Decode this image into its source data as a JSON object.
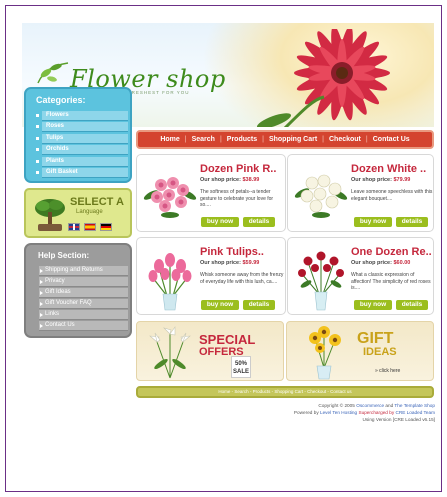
{
  "header": {
    "logo": "Flower shop",
    "tagline": "BEST FRESHEST FOR YOU"
  },
  "categories": {
    "title": "Categories:",
    "items": [
      "Flowers",
      "Roses",
      "Tulips",
      "Orchids",
      "Plants",
      "Gift Basket"
    ]
  },
  "language": {
    "title": "SELECT A",
    "subtitle": "Language"
  },
  "help": {
    "title": "Help Section:",
    "items": [
      "Shipping and Returns",
      "Privacy",
      "Gift Ideas",
      "Gift Voucher FAQ",
      "Links",
      "Contact Us"
    ]
  },
  "nav": {
    "items": [
      "Home",
      "Search",
      "Products",
      "Shopping Cart",
      "Checkout",
      "Contact Us"
    ]
  },
  "products": [
    {
      "name": "Dozen Pink R..",
      "price_label": "Our shop price:",
      "price": "$38.99",
      "desc": "The softness of petals--a tender gesture to celebrate your love for so...."
    },
    {
      "name": "Dozen White ..",
      "price_label": "Our shop price:",
      "price": "$79.99",
      "desc": "Leave someone speechless with this elegant bouquet...."
    },
    {
      "name": "Pink Tulips..",
      "price_label": "Our shop price:",
      "price": "$59.99",
      "desc": "Whisk someone away from the frenzy of everyday life with this lush, ca...."
    },
    {
      "name": "One Dozen Re..",
      "price_label": "Our shop price:",
      "price": "$60.00",
      "desc": "What a classic expression of affection! The simplicity of red roses is...."
    }
  ],
  "buttons": {
    "buy": "buy now",
    "details": "details"
  },
  "promo": {
    "special": "SPECIAL",
    "offers": "OFFERS",
    "badge": "50% SALE",
    "gift": "GIFT",
    "ideas": "IDEAS",
    "click": "» click here"
  },
  "footer": {
    "links": "Home - Search - Products - Shopping Cart - Checkout - Contact us",
    "copyright_pre": "Copyright © 2005 ",
    "copyright_a": "Osc",
    "copyright_b": "ommerce",
    "copyright_mid": " and ",
    "copyright_c": "The Template Shop",
    "powered_pre": "Powered by ",
    "powered_a": "Level Ten Hosting",
    "powered_mid": " ",
    "powered_b": "Supercharged by",
    "powered_c": " CRE Loaded Team",
    "version": "Using Version [CRE Loaded v6.15]"
  }
}
